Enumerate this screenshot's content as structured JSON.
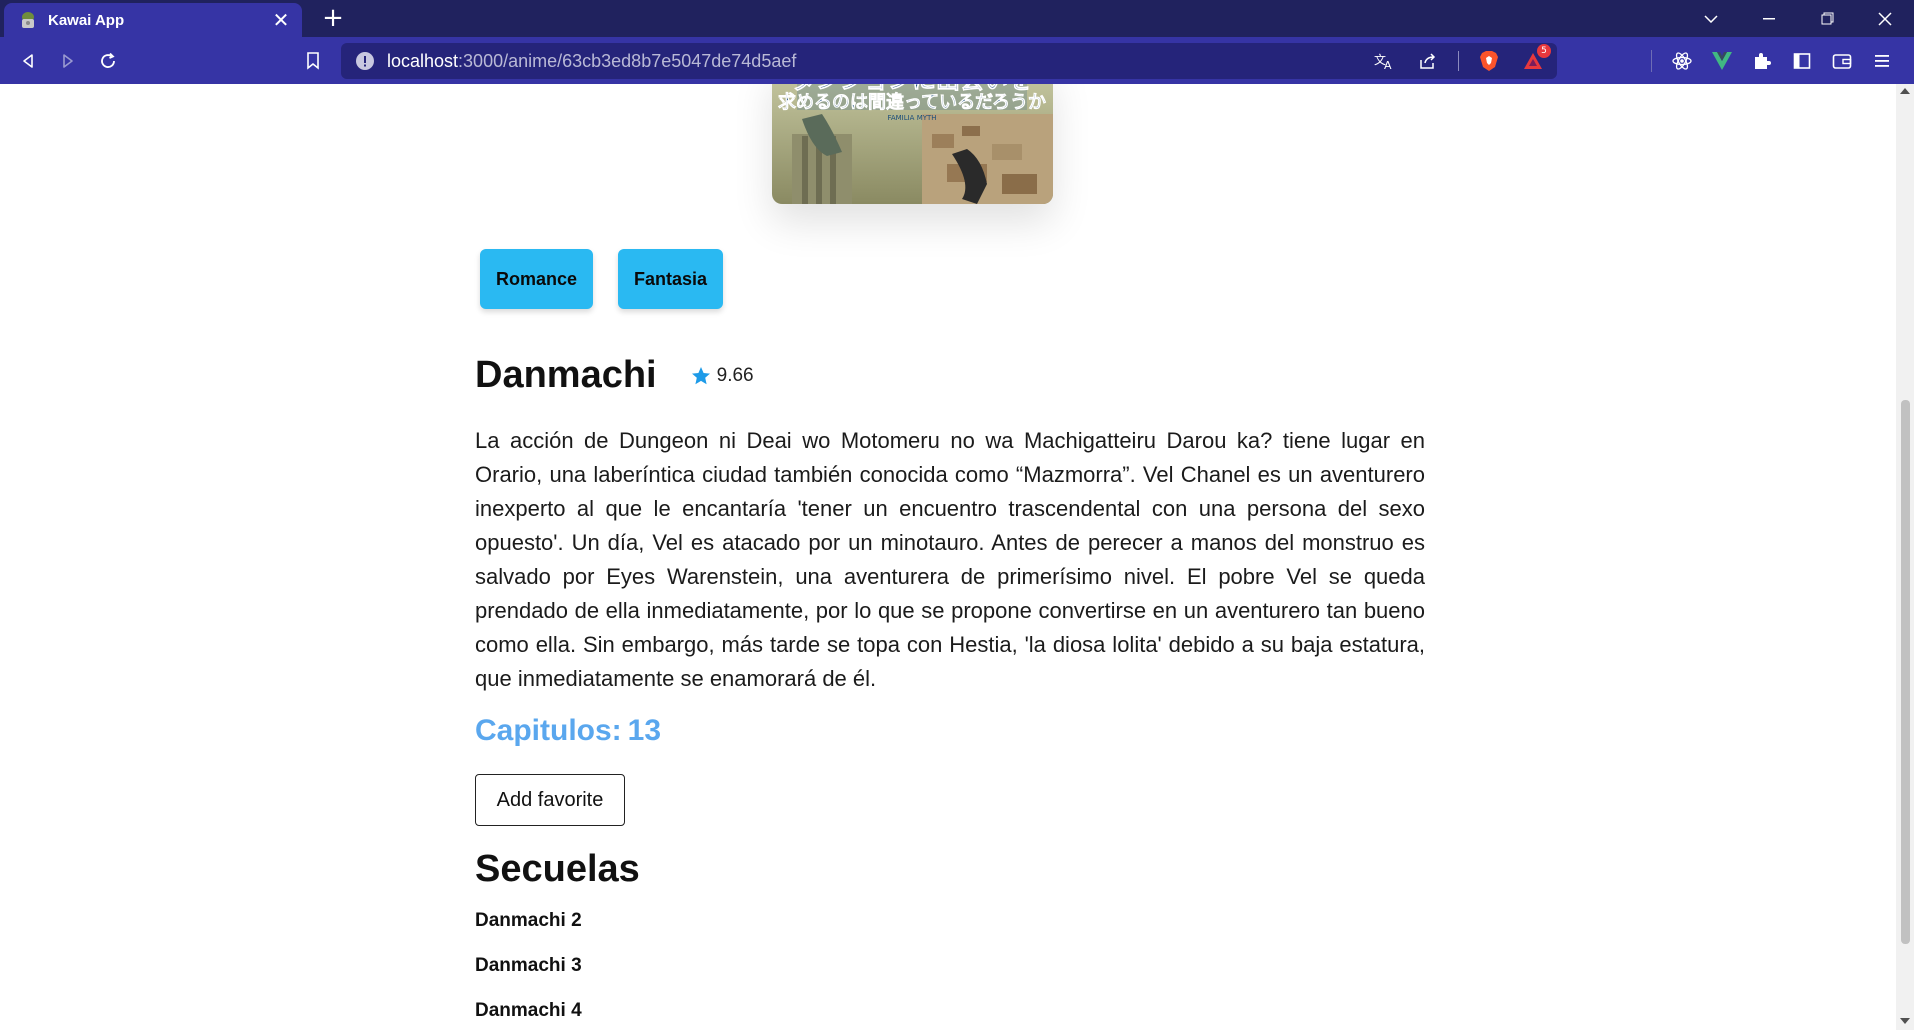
{
  "browser": {
    "tab_title": "Kawai App",
    "url_host": "localhost",
    "url_path": ":3000/anime/63cb3ed8b7e5047de74d5aef",
    "brave_badge_count": "5",
    "icons": {
      "back": "back-icon",
      "forward": "forward-icon",
      "reload": "reload-icon",
      "bookmark": "bookmark-icon",
      "translate": "translate-icon",
      "share": "share-icon",
      "brave_shield": "brave-shield-icon",
      "brave_rewards": "brave-rewards-icon",
      "react_devtools": "react-icon",
      "vue_devtools": "vue-icon",
      "extensions": "puzzle-icon",
      "sidebar": "sidebar-icon",
      "wallet": "wallet-icon",
      "menu": "menu-icon"
    }
  },
  "anime": {
    "genres": [
      "Romance",
      "Fantasia"
    ],
    "title": "Danmachi",
    "rating": "9.66",
    "synopsis": "La acción de Dungeon ni Deai wo Motomeru no wa Machigatteiru Darou ka? tiene lugar en Orario, una laberíntica ciudad también conocida como “Mazmorra”. Vel Chanel es un aventurero inexperto al que le encantaría 'tener un encuentro trascendental con una persona del sexo opuesto'. Un día, Vel es atacado por un minotauro. Antes de perecer a manos del monstruo es salvado por Eyes Warenstein, una aventurera de primerísimo nivel. El pobre Vel se queda prendado de ella inmediatamente, por lo que se propone convertirse en un aventurero tan bueno como ella. Sin embargo, más tarde se topa con Hestia, 'la diosa lolita' debido a su baja estatura, que inmediatamente se enamorará de él.",
    "chapters_label": "Capitulos:",
    "chapters_count": "13",
    "favorite_button": "Add favorite",
    "sequels_title": "Secuelas",
    "sequels": [
      "Danmachi 2",
      "Danmachi 3",
      "Danmachi 4"
    ]
  },
  "colors": {
    "tab_bar": "#20225e",
    "toolbar": "#3634a5",
    "genre_chip": "#2ab9f2",
    "accent_text": "#5aa7ee",
    "star": "#1e9be8"
  }
}
